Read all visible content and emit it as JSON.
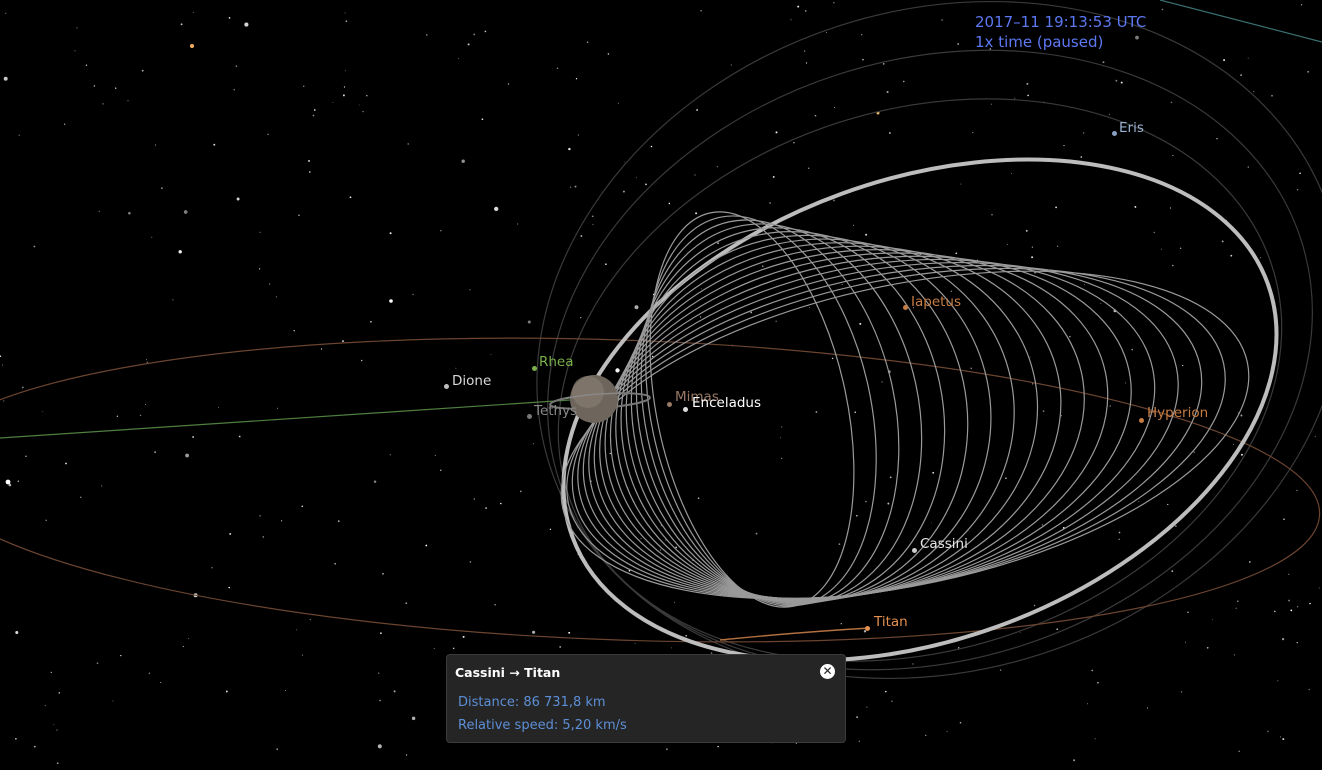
{
  "time": {
    "date_time": "2017–11 19:13:53 UTC",
    "rate": "1x time (paused)"
  },
  "bodies": [
    {
      "id": "eris",
      "label": "Eris",
      "color": "#9ab0d0"
    },
    {
      "id": "iapetus",
      "label": "Iapetus",
      "color": "#c77c42"
    },
    {
      "id": "hyperion",
      "label": "Hyperion",
      "color": "#c77c42"
    },
    {
      "id": "rhea",
      "label": "Rhea",
      "color": "#7ab04a"
    },
    {
      "id": "dione",
      "label": "Dione",
      "color": "#d9d9d9"
    },
    {
      "id": "tethys",
      "label": "Tethys",
      "color": "#888888"
    },
    {
      "id": "mimas",
      "label": "Mimas",
      "color": "#9a7a66"
    },
    {
      "id": "enceladus",
      "label": "Enceladus",
      "color": "#ffffff"
    },
    {
      "id": "cassini",
      "label": "Cassini",
      "color": "#e6e6e6"
    },
    {
      "id": "titan",
      "label": "Titan",
      "color": "#e39050"
    }
  ],
  "info_panel": {
    "title": "Cassini → Titan",
    "distance": "Distance: 86 731,8 km",
    "speed": "Relative speed: 5,20 km/s",
    "close_icon": "close-circle-icon"
  }
}
